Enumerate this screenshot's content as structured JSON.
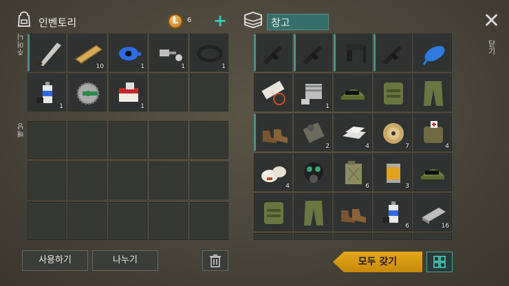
{
  "inventory": {
    "title": "인벤토리",
    "coins": "6",
    "pockets_label": "주머니",
    "backpack_label": "배낭",
    "pocket_slots": [
      {
        "icon": "machete-icon",
        "count": "",
        "equipped": true
      },
      {
        "icon": "wood-plank-icon",
        "count": "10"
      },
      {
        "icon": "blue-tape-icon",
        "count": "1"
      },
      {
        "icon": "bolt-nut-icon",
        "count": "1"
      },
      {
        "icon": "rubber-ring-icon",
        "count": "1"
      },
      {
        "icon": "spray-can-icon",
        "count": "1"
      },
      {
        "icon": "saw-blade-icon",
        "count": ""
      },
      {
        "icon": "cigarette-pack-icon",
        "count": "1"
      },
      {
        "icon": "",
        "count": ""
      },
      {
        "icon": "",
        "count": ""
      }
    ]
  },
  "buttons": {
    "use": "사용하기",
    "split": "나누기",
    "take_all": "모두 갖기",
    "close": "닫기"
  },
  "storage": {
    "title": "창고",
    "slots": [
      {
        "icon": "assault-rifle-icon",
        "count": "",
        "equipped": true
      },
      {
        "icon": "assault-rifle-icon",
        "count": "",
        "equipped": true
      },
      {
        "icon": "pistol-silencer-icon",
        "count": "",
        "equipped": true
      },
      {
        "icon": "assault-rifle-icon",
        "count": "",
        "equipped": true
      },
      {
        "icon": "blue-balloon-icon",
        "count": ""
      },
      {
        "icon": "scroll-gauge-icon",
        "count": ""
      },
      {
        "icon": "engine-part-icon",
        "count": "1"
      },
      {
        "icon": "camo-cap-icon",
        "count": ""
      },
      {
        "icon": "camo-vest-icon",
        "count": ""
      },
      {
        "icon": "camo-pants-icon",
        "count": ""
      },
      {
        "icon": "boots-icon",
        "count": "",
        "equipped": true
      },
      {
        "icon": "gear-tool-icon",
        "count": "2"
      },
      {
        "icon": "metal-ingot-icon",
        "count": "4"
      },
      {
        "icon": "wire-spool-icon",
        "count": "7"
      },
      {
        "icon": "medic-bag-icon",
        "count": "4"
      },
      {
        "icon": "bandage-icon",
        "count": "4"
      },
      {
        "icon": "gas-mask-icon",
        "count": ""
      },
      {
        "icon": "jerrycan-icon",
        "count": "6"
      },
      {
        "icon": "filter-icon",
        "count": "3"
      },
      {
        "icon": "camo-cap-icon",
        "count": ""
      },
      {
        "icon": "camo-vest-icon",
        "count": ""
      },
      {
        "icon": "camo-pants-icon",
        "count": ""
      },
      {
        "icon": "boots-icon",
        "count": ""
      },
      {
        "icon": "spray-can-icon",
        "count": "6"
      },
      {
        "icon": "metal-bar-icon",
        "count": "16"
      }
    ]
  },
  "colors": {
    "accent": "#36c9b8",
    "take_all": "#e3a81a",
    "slot": "#2f3230"
  }
}
